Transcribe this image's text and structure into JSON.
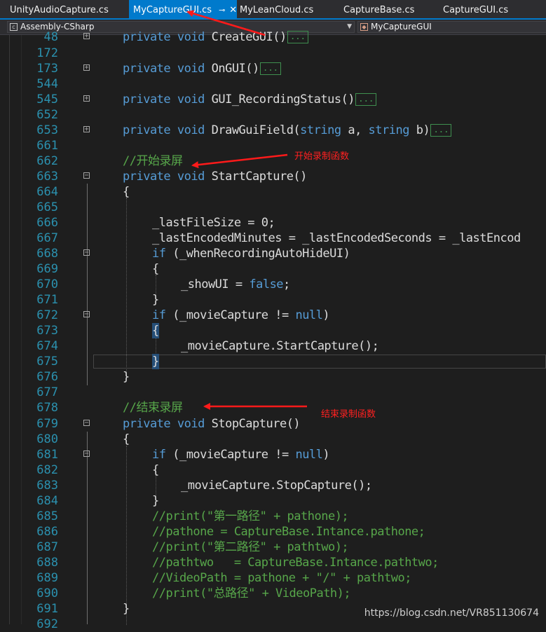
{
  "tabs": [
    {
      "label": "UnityAudioCapture.cs",
      "active": false
    },
    {
      "label": "MyCaptureGUI.cs",
      "active": true
    },
    {
      "label": "MyLeanCloud.cs",
      "active": false
    },
    {
      "label": "CaptureBase.cs",
      "active": false
    },
    {
      "label": "CaptureGUI.cs",
      "active": false
    }
  ],
  "nav": {
    "project": "Assembly-CSharp",
    "class": "MyCaptureGUI"
  },
  "lines": {
    "l48": "48",
    "l172": "172",
    "l173": "173",
    "l544": "544",
    "l545": "545",
    "l652": "652",
    "l653": "653",
    "l661": "661",
    "l662": "662",
    "l663": "663",
    "l664": "664",
    "l665": "665",
    "l666": "666",
    "l667": "667",
    "l668": "668",
    "l669": "669",
    "l670": "670",
    "l671": "671",
    "l672": "672",
    "l673": "673",
    "l674": "674",
    "l675": "675",
    "l676": "676",
    "l677": "677",
    "l678": "678",
    "l679": "679",
    "l680": "680",
    "l681": "681",
    "l682": "682",
    "l683": "683",
    "l684": "684",
    "l685": "685",
    "l686": "686",
    "l687": "687",
    "l688": "688",
    "l689": "689",
    "l690": "690",
    "l691": "691",
    "l692": "692"
  },
  "code": {
    "kw_private": "private",
    "kw_void": "void",
    "kw_if": "if",
    "kw_string": "string",
    "kw_false": "false",
    "kw_null": "null",
    "ellipsis": "...",
    "create_gui": "CreateGUI()",
    "on_gui": "OnGUI()",
    "rec_status": "GUI_RecordingStatus()",
    "draw_field_a": "DrawGuiField(",
    "draw_field_b": " a, ",
    "draw_field_c": " b)",
    "cm_start": "//开始录屏",
    "start_capture": "StartCapture()",
    "brace_open": "{",
    "brace_close": "}",
    "last_file_size": "_lastFileSize = 0;",
    "last_encoded": "_lastEncodedMinutes = _lastEncodedSeconds = _lastEncod",
    "when_rec_a": " (_whenRecordingAutoHideUI)",
    "show_ui_a": "_showUI = ",
    "show_ui_b": ";",
    "movie_if_a": " (_movieCapture != ",
    "movie_if_b": ")",
    "movie_start": "_movieCapture.StartCapture();",
    "cm_stop": "//结束录屏",
    "stop_capture": "StopCapture()",
    "movie_stop": "_movieCapture.StopCapture();",
    "c685": "//print(\"第一路径\" + pathone);",
    "c686": "//pathone = CaptureBase.Intance.pathone;",
    "c687": "//print(\"第二路径\" + pathtwo);",
    "c688": "//pathtwo   = CaptureBase.Intance.pathtwo;",
    "c689": "//VideoPath = pathone + \"/\" + pathtwo;",
    "c690": "//print(\"总路径\" + VideoPath);"
  },
  "annotations": {
    "start": "开始录制函数",
    "stop": "结束录制函数"
  },
  "watermark": "https://blog.csdn.net/VR851130674",
  "colors": {
    "keyword": "#569cd6",
    "comment": "#57a64a",
    "linenum": "#2b91af",
    "annotation": "#ff2020",
    "accent": "#007acc"
  }
}
